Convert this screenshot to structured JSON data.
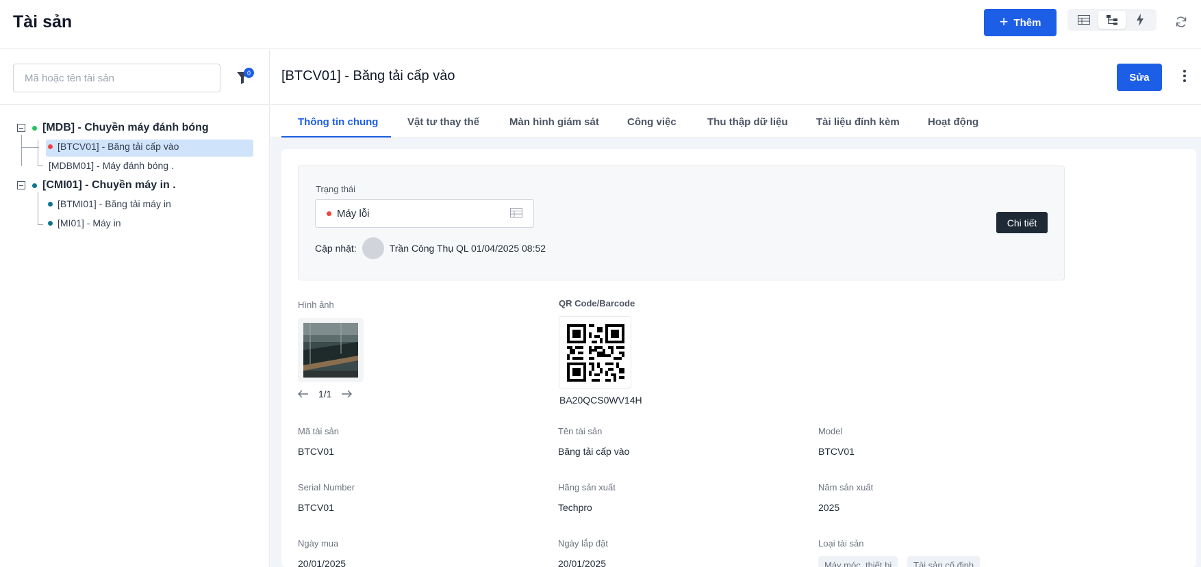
{
  "header": {
    "title": "Tài sản",
    "add_label": "Thêm",
    "view_icons": [
      "table-view-icon",
      "tree-view-icon",
      "flash-icon"
    ],
    "refresh_icon": "refresh-icon"
  },
  "sidebar": {
    "search_placeholder": "Mã hoặc tên tài sản",
    "filter_count": "0",
    "tree": [
      {
        "label": "[MDB] - Chuyền máy đánh bóng",
        "status_color": "#22c55e",
        "expanded": true,
        "children": [
          {
            "label": "[BTCV01] - Băng tải cấp vào",
            "status_color": "#ef4444",
            "selected": true
          },
          {
            "label": "[MDBM01] - Máy đánh bóng .",
            "status_color": ""
          }
        ]
      },
      {
        "label": "[CMI01] - Chuyền máy in .",
        "status_color": "#0e7490",
        "expanded": true,
        "children": [
          {
            "label": "[BTMI01] - Băng tải máy in",
            "status_color": "#0e7490"
          },
          {
            "label": "[MI01] - Máy in",
            "status_color": "#0e7490"
          }
        ]
      }
    ]
  },
  "detail": {
    "title": "[BTCV01] - Băng tải cấp vào",
    "edit_label": "Sửa",
    "tabs": [
      "Thông tin chung",
      "Vật tư thay thế",
      "Màn hình giám sát",
      "Công việc",
      "Thu thập dữ liệu",
      "Tài liệu đính kèm",
      "Hoạt động"
    ],
    "active_tab": "Thông tin chung",
    "status": {
      "label": "Trạng thái",
      "value": "Máy lỗi",
      "value_color": "#ef4444",
      "updated_label": "Cập nhật:",
      "updated_by": "Trần Công Thụ QL 01/04/2025 08:52",
      "detail_button": "Chi tiết"
    },
    "image": {
      "label": "Hình ảnh",
      "pager": "1/1"
    },
    "qr": {
      "label": "QR Code/Barcode",
      "code": "BA20QCS0WV14H"
    },
    "fields": {
      "asset_code": {
        "label": "Mã tài sản",
        "value": "BTCV01"
      },
      "asset_name": {
        "label": "Tên tài sản",
        "value": "Băng tải cấp vào"
      },
      "model": {
        "label": "Model",
        "value": "BTCV01"
      },
      "serial": {
        "label": "Serial Number",
        "value": "BTCV01"
      },
      "manufacturer": {
        "label": "Hãng sản xuất",
        "value": "Techpro"
      },
      "year": {
        "label": "Năm sản xuất",
        "value": "2025"
      },
      "purchase_date": {
        "label": "Ngày mua",
        "value": "20/01/2025"
      },
      "install_date": {
        "label": "Ngày lắp đặt",
        "value": "20/01/2025"
      },
      "asset_type": {
        "label": "Loại tài sản",
        "tags": [
          "Máy móc, thiết bị",
          "Tài sản cố định"
        ]
      }
    }
  }
}
